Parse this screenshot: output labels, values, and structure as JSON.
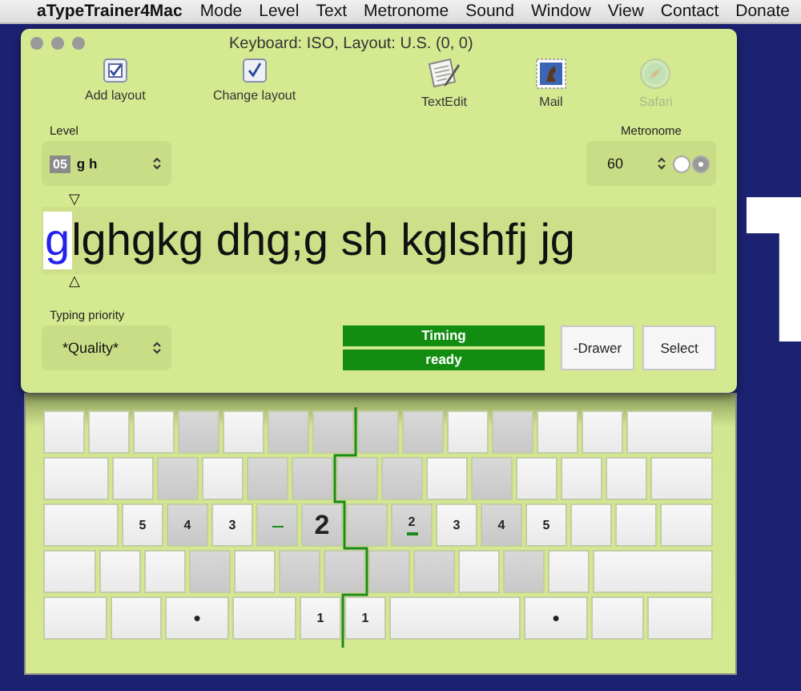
{
  "menu_bar": {
    "app_name": "aTypeTrainer4Mac",
    "items": [
      "Mode",
      "Level",
      "Text",
      "Metronome",
      "Sound",
      "Window",
      "View",
      "Contact",
      "Donate"
    ]
  },
  "window": {
    "title": "Keyboard: ISO, Layout: U.S. (0, 0)"
  },
  "toolbar": [
    {
      "label": "Add layout",
      "kind": "checkbox",
      "disabled": false
    },
    {
      "label": "Change layout",
      "kind": "check",
      "disabled": false
    },
    {
      "label": "TextEdit",
      "kind": "textedit",
      "disabled": false
    },
    {
      "label": "Mail",
      "kind": "mail",
      "disabled": false
    },
    {
      "label": "Safari",
      "kind": "compass",
      "disabled": true
    }
  ],
  "level": {
    "label": "Level",
    "badge": "05",
    "value": "g h"
  },
  "metronome": {
    "label": "Metronome",
    "value": "60",
    "options": [
      {
        "selected": false
      },
      {
        "selected": true
      }
    ]
  },
  "exercise": {
    "top_marker": "▽",
    "current": "g",
    "rest": "lghgkg dhg;g sh kglshfj jg",
    "bottom_marker": "△"
  },
  "typing_priority": {
    "label": "Typing priority",
    "value": "*Quality*"
  },
  "timing": {
    "title": "Timing",
    "status": "ready"
  },
  "buttons": [
    {
      "label": "-Drawer"
    },
    {
      "label": "Select"
    }
  ],
  "keyboard": {
    "rows": [
      {
        "keys": [
          {
            "shaded": false
          },
          {
            "shaded": false
          },
          {
            "shaded": false
          },
          {
            "shaded": true
          },
          {
            "shaded": false
          },
          {
            "shaded": true
          },
          {
            "shaded": true
          },
          {
            "shaded": true
          },
          {
            "shaded": true
          },
          {
            "shaded": false
          },
          {
            "shaded": true
          },
          {
            "shaded": false
          },
          {
            "shaded": false
          },
          {
            "shaded": false
          }
        ]
      },
      {
        "keys": [
          {
            "shaded": false
          },
          {
            "shaded": false
          },
          {
            "shaded": true
          },
          {
            "shaded": false
          },
          {
            "shaded": true
          },
          {
            "shaded": true
          },
          {
            "shaded": true
          },
          {
            "shaded": true
          },
          {
            "shaded": false
          },
          {
            "shaded": true
          },
          {
            "shaded": false
          },
          {
            "shaded": false
          },
          {
            "shaded": false
          },
          {
            "shaded": false
          }
        ]
      },
      {
        "keys": [
          {
            "shaded": false
          },
          {
            "shaded": false,
            "label": "5"
          },
          {
            "shaded": true,
            "label": "4"
          },
          {
            "shaded": false,
            "label": "3"
          },
          {
            "shaded": true,
            "underline": true
          },
          {
            "shaded": true,
            "label": "2",
            "next": true
          },
          {
            "shaded": true
          },
          {
            "shaded": true,
            "label": "2",
            "underline": true
          },
          {
            "shaded": false,
            "label": "3"
          },
          {
            "shaded": true,
            "label": "4"
          },
          {
            "shaded": false,
            "label": "5"
          },
          {
            "shaded": false
          },
          {
            "shaded": false
          },
          {
            "shaded": false
          }
        ]
      },
      {
        "keys": [
          {
            "shaded": false
          },
          {
            "shaded": false
          },
          {
            "shaded": false
          },
          {
            "shaded": true
          },
          {
            "shaded": false
          },
          {
            "shaded": true
          },
          {
            "shaded": true
          },
          {
            "shaded": true
          },
          {
            "shaded": true
          },
          {
            "shaded": false
          },
          {
            "shaded": true
          },
          {
            "shaded": false
          },
          {
            "shaded": false
          }
        ]
      },
      {
        "keys": [
          {
            "shaded": false
          },
          {
            "shaded": false
          },
          {
            "shaded": false,
            "label": "●"
          },
          {
            "shaded": false
          },
          {
            "shaded": false,
            "label": "1"
          },
          {
            "shaded": false,
            "label": "1"
          },
          {
            "shaded": false
          },
          {
            "shaded": false,
            "label": "●"
          },
          {
            "shaded": false
          },
          {
            "shaded": false
          }
        ]
      }
    ]
  }
}
